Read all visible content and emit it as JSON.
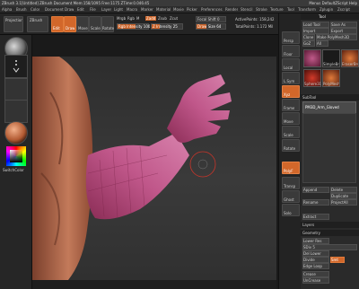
{
  "window": {
    "title": "ZBrush 3.1[Untitled]    ZBrush Document     Mem:158/1095  Free:1175  ZTime:0.046:45",
    "right_controls": "Menus   DefaultZScript   Help"
  },
  "menu": {
    "items": [
      "Alpha",
      "Brush",
      "Color",
      "Document",
      "Draw",
      "Edit",
      "File",
      "Layer",
      "Light",
      "Macro",
      "Marker",
      "Material",
      "Movie",
      "Picker",
      "Preferences",
      "Render",
      "Stencil",
      "Stroke",
      "Texture",
      "Tool",
      "Transform",
      "Zplugin",
      "Zscript"
    ]
  },
  "shelf": {
    "projection_master": "Projection Master",
    "zbrush_label": "ZBrush",
    "edit": "Edit",
    "draw": "Draw",
    "move": "Move",
    "scale": "Scale",
    "rotate": "Rotate",
    "mrgb": "Mrgb",
    "rgb": "Rgb",
    "m": "M",
    "zadd": "Zadd",
    "zsub": "Zsub",
    "zcut": "Zcut",
    "rgb_intensity": "Rgb Intensity 100",
    "z_intensity": "Z Intensity 25",
    "focal_shift": "Focal Shift 0",
    "draw_size": "Draw Size 64",
    "active_points": "ActivePoints: 158,242",
    "total_points": "TotalPoints: 1.172 Mil"
  },
  "leftbar": {
    "texture_label": "Texture",
    "switch_color": "SwitchColor"
  },
  "right_panel": {
    "title": "Tool",
    "load_tool": "Load Tool",
    "save_as": "Save As",
    "import": "Import",
    "export": "Export",
    "clone": "Clone",
    "make_polymesh": "Make PolyMesh3D",
    "go_z": "GoZ",
    "all": "All",
    "sub_tool": "SubTool",
    "append": "Append",
    "delete": "Delete",
    "duplicate": "Duplicate",
    "rename": "Rename",
    "project_all": "ProjectAll",
    "extract": "Extract",
    "layers": "Layers",
    "geometry": "Geometry",
    "lower_res": "Lower Res",
    "sdiv": "SDiv 5",
    "del_lower": "Del Lower",
    "divide": "Divide",
    "smt": "Smt",
    "edge_loop": "Edge Loop",
    "crease": "Crease",
    "uncrease": "UnCrease",
    "thumb_label": "PM3D_Arm_Gloved",
    "simple_brush": "SimpleBrush",
    "eraser": "EraserBrush",
    "sphere": "Sphere3D",
    "polymesh": "PolyMesh3D"
  },
  "rtools": {
    "labels": [
      "Persp",
      "Floor",
      "Local",
      "L.Sym",
      "Xyz",
      "Frame",
      "Move",
      "Scale",
      "Rotate",
      "PolyF",
      "Transp",
      "Ghost",
      "Solo"
    ]
  },
  "colors": {
    "accent": "#d2672a",
    "glove": "#b04a78",
    "skin": "#b86a4e",
    "background": "#1a1a1a"
  }
}
